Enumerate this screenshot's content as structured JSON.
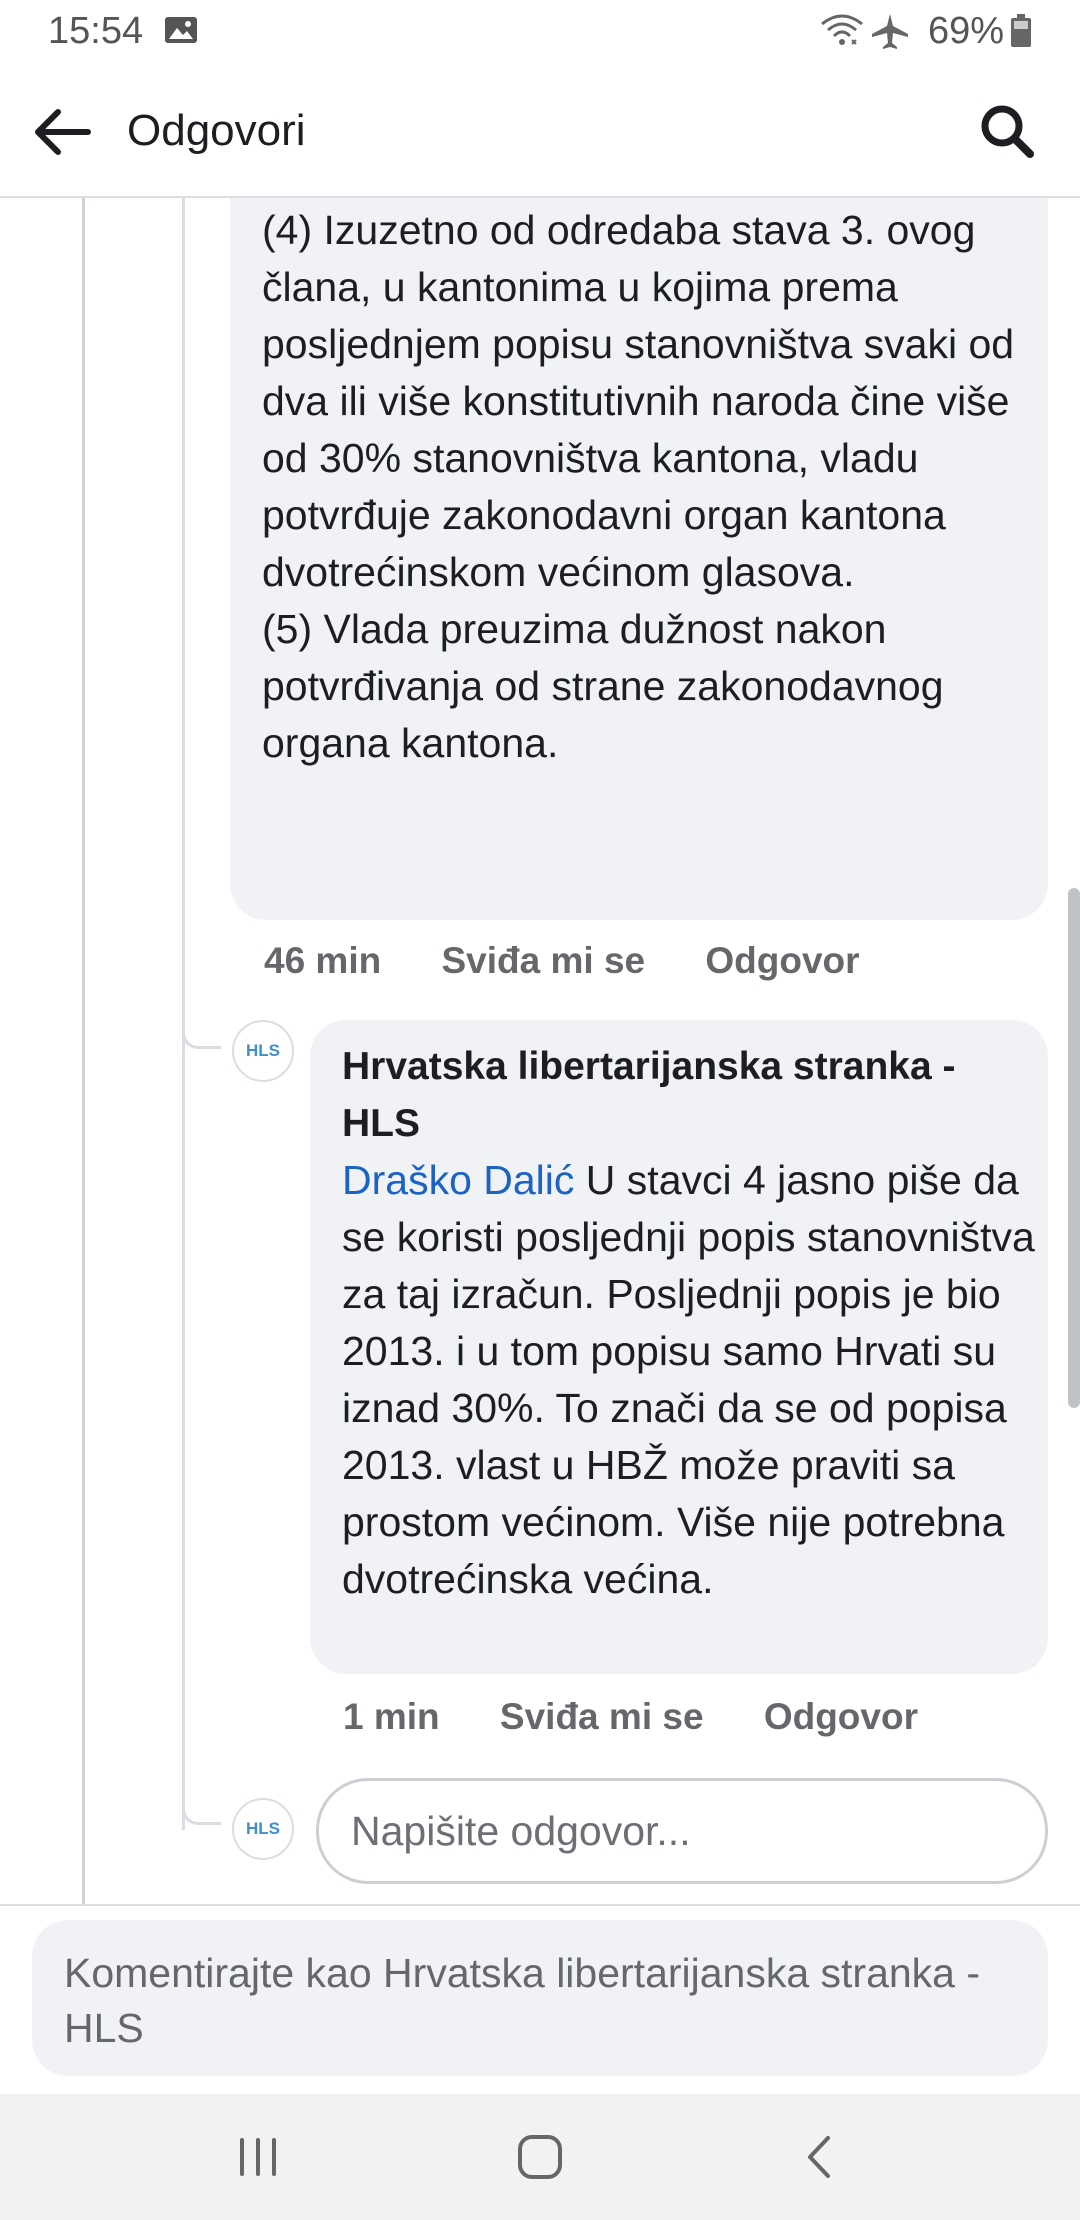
{
  "status_bar": {
    "time": "15:54",
    "battery": "69%"
  },
  "header": {
    "title": "Odgovori"
  },
  "comment1": {
    "text": "(4) Izuzetno od odredaba stava 3. ovog člana, u kantonima u kojima prema posljednjem popisu stanovništva svaki od dva ili više konstitutivnih naroda čine više od 30% stanovništva kantona, vladu potvrđuje zakonodavni organ kantona dvotrećinskom većinom glasova.\n(5) Vlada preuzima dužnost nakon potvrđivanja od strane zakonodavnog organa kantona.",
    "time": "46 min",
    "like": "Sviđa mi se",
    "reply": "Odgovor"
  },
  "comment2": {
    "avatar": "HLS",
    "author": "Hrvatska libertarijanska stranka - HLS",
    "mention": "Draško Dalić",
    "text": "U stavci 4 jasno piše da se koristi posljednji popis stanovništva za taj izračun. Posljednji popis je bio 2013. i u tom popisu samo Hrvati su iznad 30%. To znači da se od popisa 2013. vlast u HBŽ može praviti sa prostom većinom. Više nije potrebna dvotrećinska većina.",
    "time": "1 min",
    "like": "Sviđa mi se",
    "reply": "Odgovor"
  },
  "reply_box": {
    "avatar": "HLS",
    "placeholder": "Napišite odgovor..."
  },
  "composer": {
    "placeholder": "Komentirajte kao Hrvatska libertarijanska stranka - HLS"
  },
  "icons": {
    "status_image": "image-icon",
    "wifi": "wifi-icon",
    "airplane": "airplane-mode-icon",
    "battery": "battery-icon",
    "back": "arrow-left-icon",
    "search": "search-icon",
    "recents": "recent-apps-icon",
    "home": "home-icon",
    "nav_back": "chevron-left-icon"
  },
  "colors": {
    "mention": "#1b63c4",
    "bubble": "#f0f2f5",
    "meta": "#65676b"
  }
}
